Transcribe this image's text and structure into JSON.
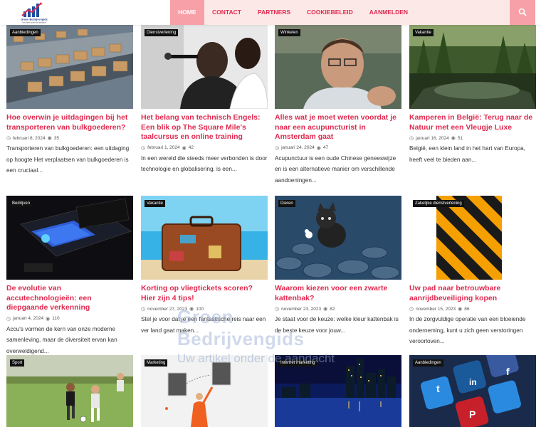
{
  "brand": {
    "name": "Groen Bedrijvengids",
    "tagline": "Uw artikel onder de aandacht"
  },
  "nav": {
    "items": [
      {
        "label": "Home",
        "active": true
      },
      {
        "label": "Contact",
        "active": false
      },
      {
        "label": "Partners",
        "active": false
      },
      {
        "label": "Cookiebeleid",
        "active": false
      },
      {
        "label": "Aanmelden",
        "active": false
      }
    ],
    "search_icon": "search-icon"
  },
  "colors": {
    "accent": "#e02a4f",
    "nav_bg": "#fde8e8",
    "nav_active": "#f7a0a8"
  },
  "watermark": {
    "line1": "Groen Bedrijvengids",
    "line2": "Uw artikel onder de aandacht"
  },
  "posts": [
    {
      "category": "Aanbiedingen",
      "title": "Hoe overwin je uitdagingen bij het transporteren van bulkgoederen?",
      "date": "februari 8, 2024",
      "views": "35",
      "excerpt": "Transporteren van bulkgoederen: een uitdaging op hoogte Het verplaatsen van bulkgoederen is een cruciaal..."
    },
    {
      "category": "Dienstverlening",
      "title": "Het belang van technisch Engels: Een blik op The Square Mile's taalcursus en online training",
      "date": "februari 1, 2024",
      "views": "42",
      "excerpt": "In een wereld die steeds meer verbonden is door technologie en globalisering, is een..."
    },
    {
      "category": "Winkelen",
      "title": "Alles wat je moet weten voordat je naar een acupuncturist in Amsterdam gaat",
      "date": "januari 24, 2024",
      "views": "47",
      "excerpt": "Acupunctuur is een oude Chinese geneeswijze en is een alternatieve manier om verschillende aandoeningen..."
    },
    {
      "category": "Vakantie",
      "title": "Kamperen in België: Terug naar de Natuur met een Vleugje Luxe",
      "date": "januari 16, 2024",
      "views": "51",
      "excerpt": "België, een klein land in het hart van Europa, heeft veel te bieden aan..."
    },
    {
      "category": "Bedrijven",
      "title": "De evolutie van accutechnologieën: een diepgaande verkenning",
      "date": "januari 4, 2024",
      "views": "110",
      "excerpt": "Accu's vormen de kern van onze moderne samenleving, maar de diversiteit ervan kan overweldigend..."
    },
    {
      "category": "Vakantie",
      "title": "Korting op vliegtickets scoren? Hier zijn 4 tips!",
      "date": "november 27, 2023",
      "views": "100",
      "excerpt": "Stel je voor dat je een fantastische reis naar een ver land gaat maken..."
    },
    {
      "category": "Dieren",
      "title": "Waarom kiezen voor een zwarte kattenbak?",
      "date": "november 23, 2023",
      "views": "82",
      "excerpt": "Je staat voor de keuze: welke kleur kattenbak is de beste keuze voor jouw..."
    },
    {
      "category": "Zakelijke dienstverlening",
      "title": "Uw pad naar betrouwbare aanrijdbeveiliging kopen",
      "date": "november 15, 2023",
      "views": "86",
      "excerpt": "In de zorgvuldige operatie van een bloeiende onderneming, kunt u zich geen verstoringen veroorloven..."
    },
    {
      "category": "Sport"
    },
    {
      "category": "Marketing"
    },
    {
      "category": "Internet marketing"
    },
    {
      "category": "Aanbiedingen"
    }
  ],
  "thumb_images": [
    "conveyor-boxes",
    "speaker-microphone",
    "man-glasses",
    "lake-forest",
    "battery-device",
    "suitcase-beach",
    "kitten-rocks",
    "hazard-stripes",
    "football-players",
    "marketing-illustration",
    "city-night-skyline",
    "social-media-icons"
  ]
}
